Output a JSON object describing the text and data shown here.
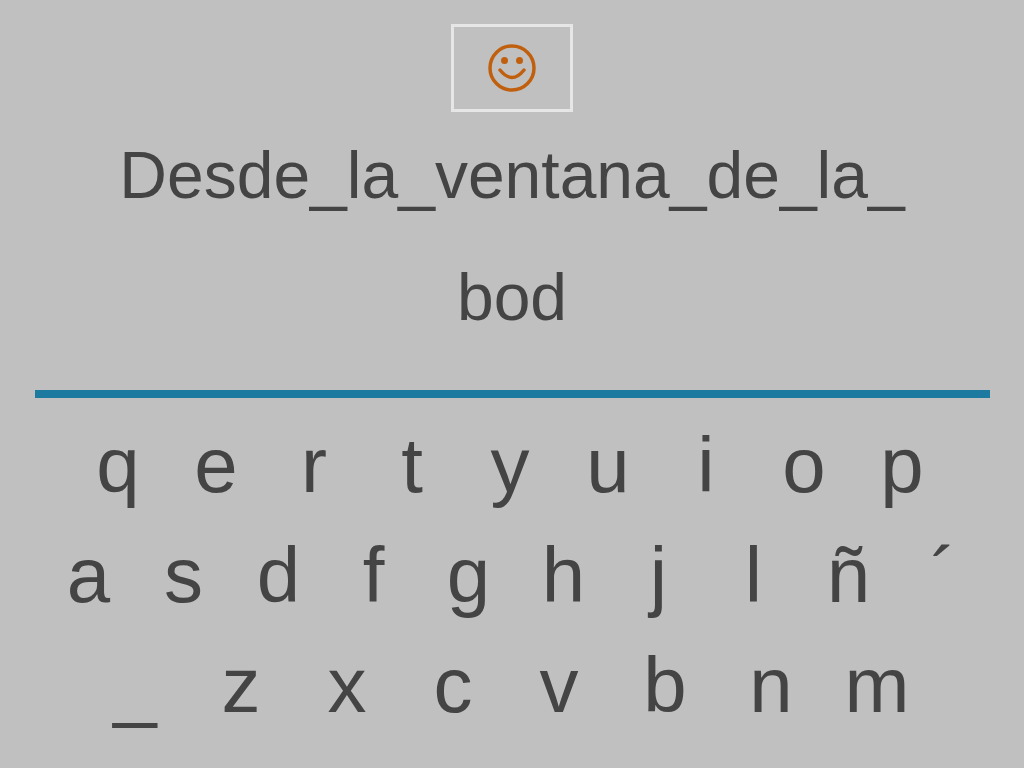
{
  "feedback": {
    "kind": "happy"
  },
  "prompt_lines": [
    "Desde_la_ventana_de_la_",
    "bod"
  ],
  "keyboard_rows": [
    [
      "q",
      "e",
      "r",
      "t",
      "y",
      "u",
      "i",
      "o",
      "p"
    ],
    [
      "a",
      "s",
      "d",
      "f",
      "g",
      "h",
      "j",
      "l",
      "ñ",
      "´"
    ],
    [
      "_",
      "z",
      "x",
      "c",
      "v",
      "b",
      "n",
      "m"
    ]
  ]
}
